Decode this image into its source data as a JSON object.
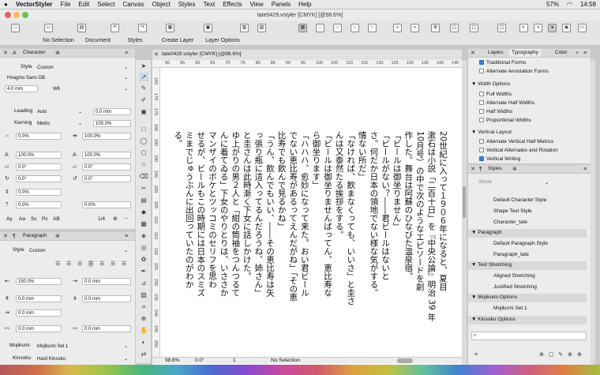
{
  "menubar": {
    "app": "VectorStyler",
    "items": [
      "File",
      "Edit",
      "Select",
      "Canvas",
      "Object",
      "Styles",
      "Text",
      "Effects",
      "View",
      "Panels",
      "Help"
    ],
    "status": "57%",
    "time": "14:58"
  },
  "window": {
    "title": "tate0429.vstyler [CMYK] [@98.6%]"
  },
  "tabs": {
    "no_selection": "No Selection",
    "document": "Document",
    "styles": "Styles",
    "create_layer": "Create Layer",
    "layer_options": "Layer Options"
  },
  "character": {
    "title": "Character",
    "style_label": "Style",
    "style_value": "Custom",
    "font": "Hiragino Sans GB",
    "size": "4.0 mm",
    "weight": "W6",
    "leading_label": "Leading",
    "leading_value": "Auto",
    "leading_mm": "0.0 mm",
    "kerning_label": "Kerning",
    "kerning_value": "Metric",
    "kerning_pct": "100.0%",
    "tracking": "0.0%",
    "tracking2": "100.0%",
    "hscale": "100.0%",
    "vscale": "100.0%",
    "skew1": "0.0°",
    "skew2": "0.0°",
    "rotate1": "0.0°",
    "rotate2": "0.0°",
    "baseline": "0.0%",
    "shift": "0.0%",
    "caps": [
      "Ay",
      "Aa",
      "Sc",
      "Pc",
      "AB",
      "1/4"
    ]
  },
  "paragraph": {
    "title": "Paragraph",
    "style_label": "Style",
    "style_value": "Custom",
    "indent_pct": "150.0%",
    "f1": "0.0 mm",
    "f2": "0.0 mm",
    "f3": "0.0 mm",
    "f4": "0.0 mm",
    "f5": "0.0 mm",
    "f6": "0.0 mm",
    "mojikumi_label": "Mojikumi",
    "mojikumi_value": "Mojikumi Set 1",
    "kinsoku_label": "Kinsoku",
    "kinsoku_value": "Hard Kinsoku"
  },
  "doc_tab": "tate0429.vstyler [CMYK] [@98.6%]",
  "ruler_top": [
    "50",
    "55",
    "60",
    "65",
    "70",
    "75",
    "80",
    "85",
    "90",
    "95",
    "100",
    "105",
    "110",
    "115",
    "120",
    "125",
    "130",
    "135",
    "140",
    "145"
  ],
  "ruler_left": [
    "165",
    "170",
    "175",
    "180",
    "185",
    "190",
    "195",
    "200",
    "205",
    "210",
    "215",
    "220",
    "225",
    "230",
    "235",
    "240",
    "245",
    "250"
  ],
  "text_columns": [
    "20世紀に入って１９０６年になると、夏目",
    "漱石は小説「二百十日」を『中央公論』明治 39 年",
    "10月号）の中で次のようなエピソードを創",
    "作した。舞台は阿蘇のひなびた温泉宿。",
    "「ビールは御坐りません」",
    "「ビールがない？――君ビールはないと",
    "さ。何だか日本の領地でない様な気がする。",
    "情ない所だ」",
    "「なければ、飲まなくっても、いいさ」と圭さ",
    "んは又泰然たる挨拶をする。",
    "「ビールは御坐りませんばってん、恵比寿な",
    "ら御坐ります」",
    "「ハハハ、愈妙になって来た。おい君ビール",
    "でない恵比寿があるってえんだがね」「その恵",
    "比寿でも飲んで見るかね」",
    "「うん、飲んでもいい、――その恵比寿は矢",
    "っ張り瓶に這入ってるんだろうね、姉さん」",
    "と圭さんは此時漸く下女に話しかけた。",
    "ゆ上がりの男２人と「紺の筒袖をつんつるて",
    "んに着てゐる」下女のやりとりは、いささか",
    "マンザイのボケとツッコミのセリフを思わ",
    "せるが、ビールもこの時期には日本のスミズ",
    "ミまでじゅうぶんに出回っていたのがわか",
    "る。"
  ],
  "statusbar": {
    "zoom": "98.6%",
    "angle": "0.0°",
    "page": "1",
    "selection": "No Selection"
  },
  "right_panel": {
    "tabs": [
      "Layers",
      "Typography",
      "Color"
    ],
    "traditional": "Traditional Forms",
    "alt_annotation": "Alternate Annotation Forms",
    "width_options": "Width Options",
    "full_widths": "Full Widths",
    "alt_half": "Alternate Half Widths",
    "half_widths": "Half Widths",
    "prop_widths": "Proportional Widths",
    "vertical_layout": "Vertical Layout",
    "alt_vert_half": "Alternate Vertical Half Metrics",
    "vert_alt_rot": "Vertical Alternates and Rotation",
    "vertical_writing": "Vertical Writing"
  },
  "styles_panel": {
    "title": "Styles",
    "mode_label": "Mode",
    "char_items": [
      "Default Character Style",
      "Shape Text Style",
      "Character_tate"
    ],
    "paragraph_group": "Paragraph",
    "para_items": [
      "Default Paragraph Style",
      "Paragraph_tate"
    ],
    "text_stretching": "Text Stretching",
    "stretch_items": [
      "Aligned Stretching",
      "Justified Stretching"
    ],
    "mojikumi_group": "Mojikumi Options",
    "mojikumi_items": [
      "Mojikumi Set 1"
    ],
    "kinsoku_group": "Kinsoku Options"
  }
}
